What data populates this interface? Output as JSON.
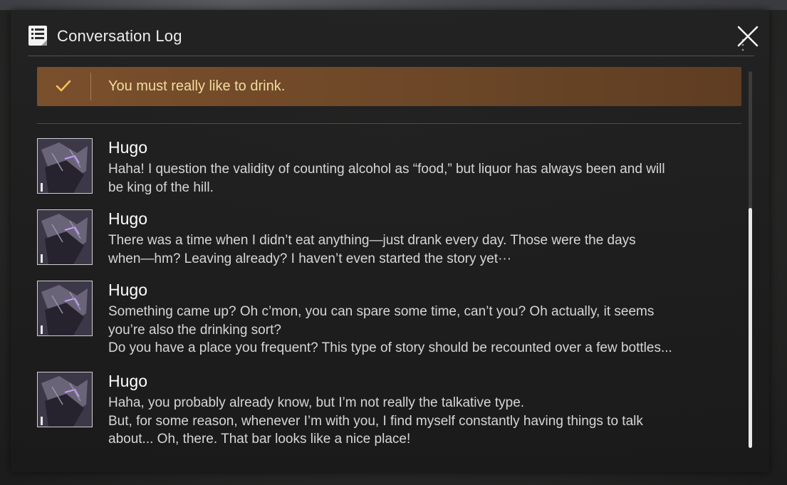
{
  "header": {
    "title": "Conversation Log",
    "icon": "log-icon",
    "close_icon": "close-icon"
  },
  "selected_choice": {
    "text": "You must really like to drink.",
    "icon": "check-icon",
    "accent_color": "#f4c25a"
  },
  "entries": [
    {
      "speaker": "Hugo",
      "avatar": "hugo-portrait",
      "lines": [
        "Haha! I question the validity of counting alcohol as “food,” but liquor has always been and will",
        "be king of the hill."
      ]
    },
    {
      "speaker": "Hugo",
      "avatar": "hugo-portrait",
      "lines": [
        "There was a time when I didn’t eat anything—just drank every day. Those were the days",
        "when—hm? Leaving already? I haven’t even started the story yet···"
      ]
    },
    {
      "speaker": "Hugo",
      "avatar": "hugo-portrait",
      "lines": [
        "Something came up? Oh c’mon, you can spare some time, can’t you? Oh actually, it seems",
        "you’re also the drinking sort?",
        "Do you have a place you frequent? This type of story should be recounted over a few bottles..."
      ]
    },
    {
      "speaker": "Hugo",
      "avatar": "hugo-portrait",
      "lines": [
        "Haha, you probably already know, but I’m not really the talkative type.",
        "But, for some reason, whenever I’m with you, I find myself constantly having things to talk",
        "about... Oh, there. That bar looks like a nice place!"
      ]
    }
  ]
}
